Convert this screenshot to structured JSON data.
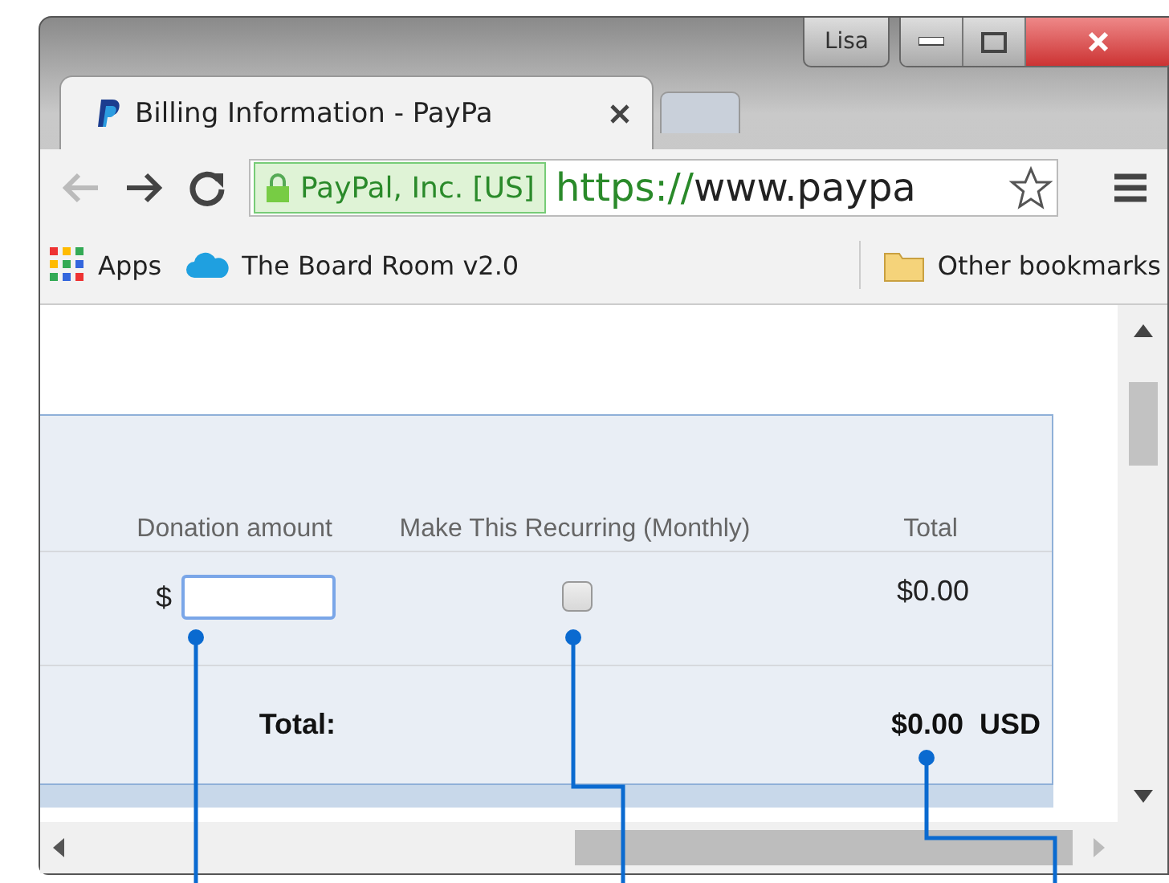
{
  "window": {
    "profile": "Lisa"
  },
  "tabs": [
    {
      "title": "Billing Information - PayPa",
      "selected": true
    },
    {
      "selected": false
    }
  ],
  "address_bar": {
    "identity": "PayPal, Inc. [US]",
    "scheme": "https://",
    "url": "www.paypa",
    "back_disabled": true
  },
  "bookmarks": [
    {
      "kind": "apps",
      "label": "Apps"
    },
    {
      "kind": "cloud",
      "label": "The Board Room v2.0"
    }
  ],
  "other_bookmarks": "Other bookmarks",
  "table": {
    "columns": [
      "Donation amount",
      "Make This Recurring (Monthly)",
      "Total"
    ],
    "row": {
      "currency": "$",
      "recurring": false,
      "total": "$0.00"
    },
    "footer": {
      "label": "Total:",
      "amount": "$0.00",
      "currency": "USD"
    }
  }
}
